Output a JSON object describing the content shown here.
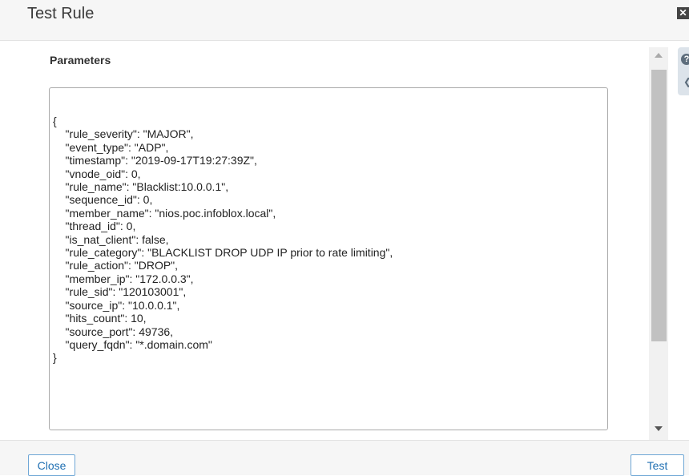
{
  "dialog": {
    "title": "Test Rule",
    "close_icon": "close-icon"
  },
  "parameters": {
    "label": "Parameters",
    "json_lines": [
      "{",
      "    \"rule_severity\": \"MAJOR\",",
      "    \"event_type\": \"ADP\",",
      "    \"timestamp\": \"2019-09-17T19:27:39Z\",",
      "    \"vnode_oid\": 0,",
      "    \"rule_name\": \"Blacklist:10.0.0.1\",",
      "    \"sequence_id\": 0,",
      "    \"member_name\": \"nios.poc.infoblox.local\",",
      "    \"thread_id\": 0,",
      "    \"is_nat_client\": false,",
      "    \"rule_category\": \"BLACKLIST DROP UDP IP prior to rate limiting\",",
      "    \"rule_action\": \"DROP\",",
      "    \"member_ip\": \"172.0.0.3\",",
      "    \"rule_sid\": \"120103001\",",
      "    \"source_ip\": \"10.0.0.1\",",
      "    \"hits_count\": 10,",
      "    \"source_port\": 49736,",
      "    \"query_fqdn\": \"*.domain.com\"",
      "}"
    ]
  },
  "help": {
    "icon": "help-icon",
    "arrow_icon": "collapse-arrow-icon"
  },
  "footer": {
    "close_label": "Close",
    "test_label": "Test"
  }
}
